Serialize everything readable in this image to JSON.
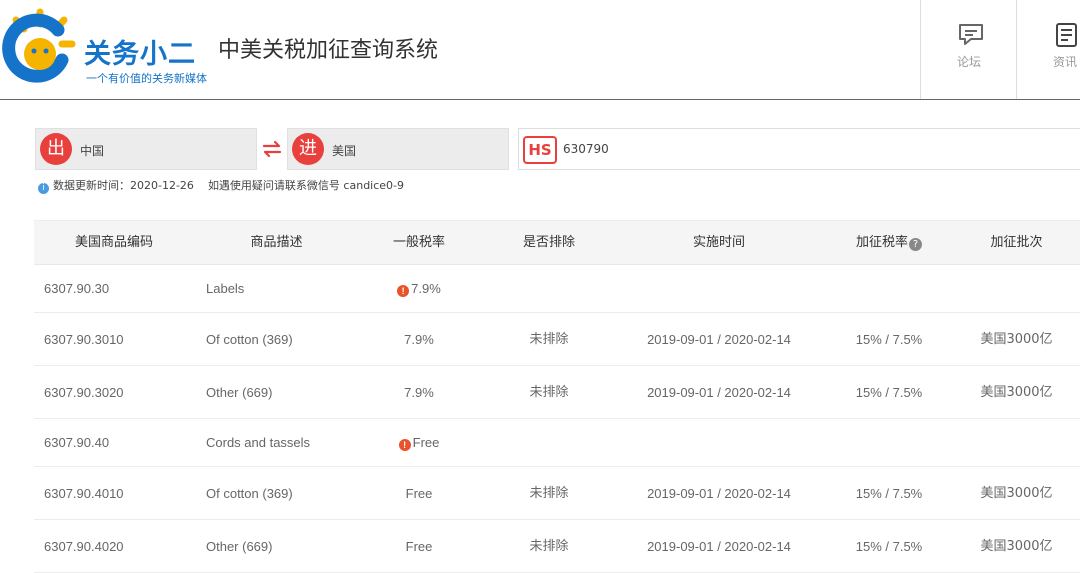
{
  "header": {
    "brand": "关务小二",
    "slogan": "一个有价值的关务新媒体",
    "app_title": "中美关税加征查询系统",
    "nav": [
      {
        "label": "论坛",
        "icon": "forum-icon"
      },
      {
        "label": "资讯",
        "icon": "news-icon"
      }
    ]
  },
  "search": {
    "export_badge": "出",
    "export_country": "中国",
    "import_badge": "进",
    "import_country": "美国",
    "hs_badge": "HS",
    "hs_code": "630790"
  },
  "notice": {
    "update_label": "数据更新时间：",
    "update_date": "2020-12-26",
    "contact": "如遇使用疑问请联系微信号 candice0-9"
  },
  "table": {
    "headers": [
      "美国商品编码",
      "商品描述",
      "一般税率",
      "是否排除",
      "实施时间",
      "加征税率",
      "加征批次"
    ],
    "rows": [
      {
        "code": "6307.90.30",
        "desc": "Labels",
        "rate": "7.9%",
        "rate_warn": true,
        "excluded": "",
        "period": "",
        "extra": "",
        "batch": ""
      },
      {
        "code": "6307.90.3010",
        "desc": "Of cotton (369)",
        "rate": "7.9%",
        "rate_warn": false,
        "excluded": "未排除",
        "period": "2019-09-01 / 2020-02-14",
        "extra": "15% / 7.5%",
        "batch": "美国3000亿"
      },
      {
        "code": "6307.90.3020",
        "desc": "Other (669)",
        "rate": "7.9%",
        "rate_warn": false,
        "excluded": "未排除",
        "period": "2019-09-01 / 2020-02-14",
        "extra": "15% / 7.5%",
        "batch": "美国3000亿"
      },
      {
        "code": "6307.90.40",
        "desc": "Cords and tassels",
        "rate": "Free",
        "rate_warn": true,
        "excluded": "",
        "period": "",
        "extra": "",
        "batch": ""
      },
      {
        "code": "6307.90.4010",
        "desc": "Of cotton (369)",
        "rate": "Free",
        "rate_warn": false,
        "excluded": "未排除",
        "period": "2019-09-01 / 2020-02-14",
        "extra": "15% / 7.5%",
        "batch": "美国3000亿"
      },
      {
        "code": "6307.90.4020",
        "desc": "Other (669)",
        "rate": "Free",
        "rate_warn": false,
        "excluded": "未排除",
        "period": "2019-09-01 / 2020-02-14",
        "extra": "15% / 7.5%",
        "batch": "美国3000亿"
      }
    ]
  },
  "colors": {
    "brand_blue": "#1573c9",
    "logo_yellow": "#f5b400",
    "badge_red": "#e8413d",
    "warn_orange": "#e8532a"
  }
}
